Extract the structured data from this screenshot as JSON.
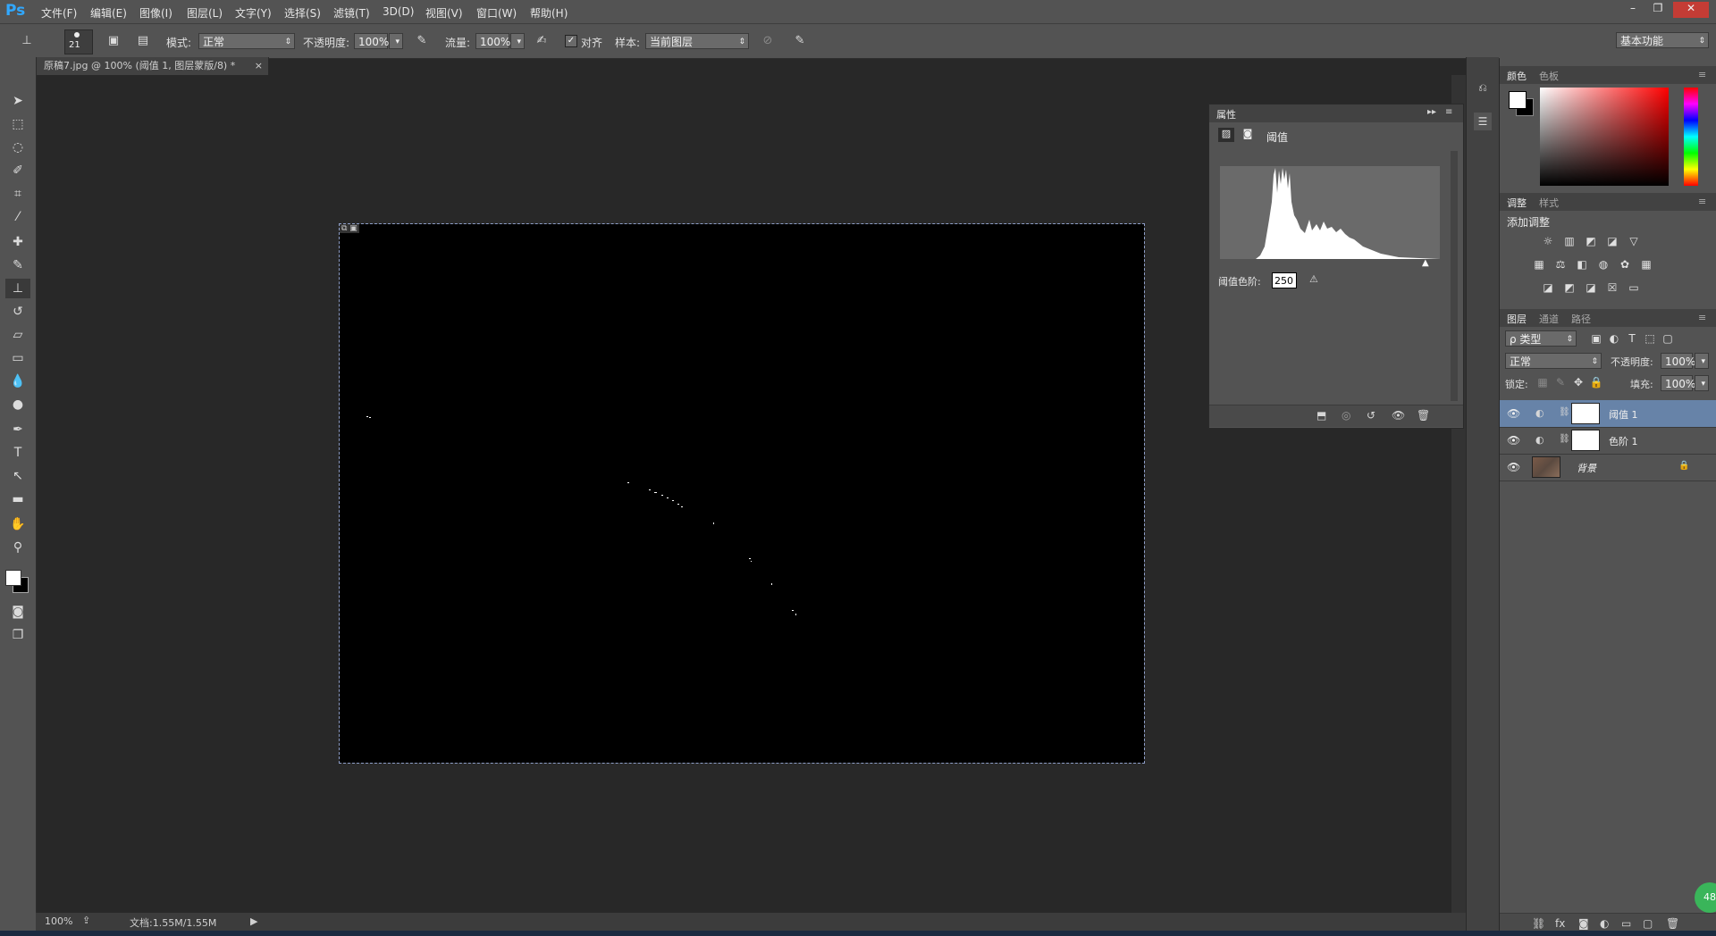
{
  "app": {
    "logo": "Ps"
  },
  "menu": [
    "文件(F)",
    "编辑(E)",
    "图像(I)",
    "图层(L)",
    "文字(Y)",
    "选择(S)",
    "滤镜(T)",
    "3D(D)",
    "视图(V)",
    "窗口(W)",
    "帮助(H)"
  ],
  "window_controls": {
    "minimize": "–",
    "restore": "❐",
    "close": "✕"
  },
  "options": {
    "brush_size": "21",
    "mode_label": "模式:",
    "mode_value": "正常",
    "opacity_label": "不透明度:",
    "opacity_value": "100%",
    "flow_label": "流量:",
    "flow_value": "100%",
    "align_label": "对齐",
    "align_checked": true,
    "sample_label": "样本:",
    "sample_value": "当前图层",
    "workspace": "基本功能"
  },
  "document": {
    "tab_title": "原稿7.jpg @ 100% (阈值 1, 图层蒙版/8) *",
    "zoom": "100%",
    "doc_info": "文档:1.55M/1.55M"
  },
  "properties": {
    "panel_title": "属性",
    "adjustment_name": "阈值",
    "threshold_label": "阈值色阶:",
    "threshold_value": "250"
  },
  "color_panel": {
    "tabs": [
      "颜色",
      "色板"
    ],
    "foreground": "#ffffff",
    "background": "#000000"
  },
  "adjustments_panel": {
    "tabs": [
      "调整",
      "样式"
    ],
    "add_label": "添加调整"
  },
  "layers_panel": {
    "tabs": [
      "图层",
      "通道",
      "路径"
    ],
    "filter": "ρ 类型",
    "blend_mode": "正常",
    "opacity_label": "不透明度:",
    "opacity_value": "100%",
    "lock_label": "锁定:",
    "fill_label": "填充:",
    "fill_value": "100%",
    "layers": [
      {
        "name": "阈值 1",
        "selected": true
      },
      {
        "name": "色阶 1",
        "selected": false
      },
      {
        "name": "背景",
        "selected": false
      }
    ]
  },
  "badge": "48"
}
